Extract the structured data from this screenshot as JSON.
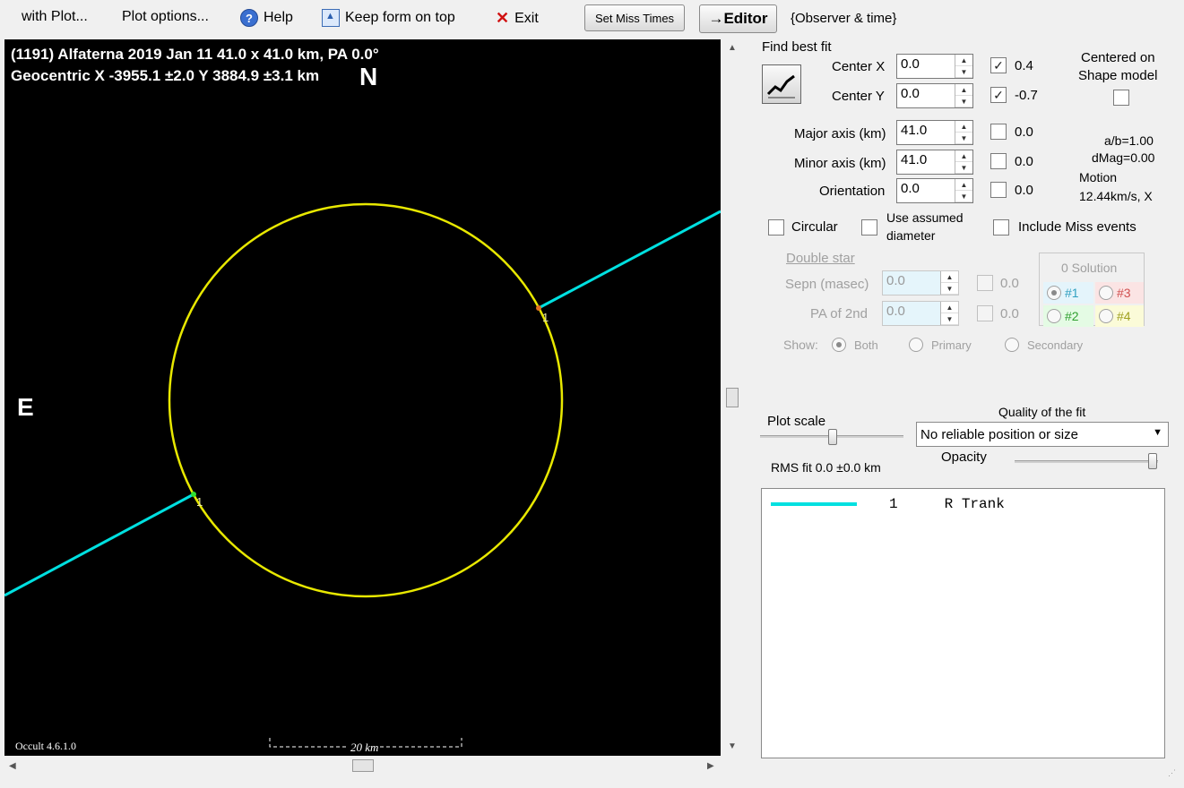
{
  "menu": {
    "with_plot": "with Plot...",
    "plot_options": "Plot options...",
    "help": "Help",
    "keep_form": "Keep form on top",
    "exit": "Exit",
    "set_miss_times": "Set Miss Times",
    "editor": "→Editor",
    "observer_time": "{Observer & time}"
  },
  "plot": {
    "title_line1": "(1191) Alfaterna  2019 Jan 11   41.0 x 41.0 km, PA 0.0°",
    "title_line2": "Geocentric  X  -3955.1 ±2.0   Y 3884.9 ±3.1  km",
    "north": "N",
    "east": "E",
    "chord_label_1": "1",
    "chord_label_2": "1",
    "version": "Occult 4.6.1.0",
    "scale_label": "20 km",
    "colors": {
      "ellipse": "#e8e800",
      "chord": "#00e0e0",
      "background": "#000000"
    }
  },
  "fit": {
    "find_best_fit": "Find best fit",
    "center_x_label": "Center X",
    "center_x": "0.0",
    "center_x_chk": "0.4",
    "center_y_label": "Center Y",
    "center_y": "0.0",
    "center_y_chk": "-0.7",
    "major_label": "Major axis (km)",
    "major": "41.0",
    "major_chk": "0.0",
    "minor_label": "Minor axis (km)",
    "minor": "41.0",
    "minor_chk": "0.0",
    "orient_label": "Orientation",
    "orient": "0.0",
    "orient_chk": "0.0",
    "centered_on": "Centered on",
    "shape_model": "Shape model",
    "ab": "a/b=1.00",
    "dmag": "dMag=0.00",
    "motion": "Motion",
    "motion_val": "12.44km/s, X",
    "circular": "Circular",
    "use_assumed_1": "Use assumed",
    "use_assumed_2": "diameter",
    "include_miss": "Include Miss events"
  },
  "double_star": {
    "title": "Double star",
    "sepn_label": "Sepn (masec)",
    "sepn": "0.0",
    "sepn_chk": "0.0",
    "pa_label": "PA of 2nd",
    "pa": "0.0",
    "pa_chk": "0.0",
    "show": "Show:",
    "both": "Both",
    "primary": "Primary",
    "secondary": "Secondary",
    "solution_title": "0 Solution",
    "sol1": "#1",
    "sol2": "#2",
    "sol3": "#3",
    "sol4": "#4"
  },
  "bottom": {
    "plot_scale": "Plot scale",
    "quality": "Quality of the fit",
    "quality_value": "No reliable position or size",
    "opacity": "Opacity",
    "rms": "RMS fit 0.0 ±0.0 km"
  },
  "list": [
    {
      "num": "1",
      "name": "R Trank",
      "color": "#00e0e0"
    }
  ]
}
